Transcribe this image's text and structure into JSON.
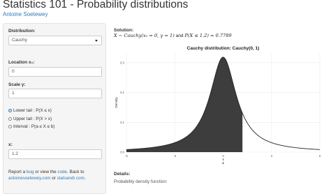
{
  "header": {
    "title": "Statistics 101 - Probability distributions",
    "author": "Antoine Soetewey"
  },
  "sidebar": {
    "distribution_label": "Distribution:",
    "distribution_value": "Cauchy",
    "location_label": "Location x₀:",
    "location_value": "0",
    "scale_label": "Scale γ:",
    "scale_value": "1",
    "tail_options": [
      "Lower tail : P(X ≤ x)",
      "Upper tail : P(X > x)",
      "Interval : P(a ≤ X ≤ b)"
    ],
    "selected_tail": 0,
    "x_label": "x:",
    "x_value": "1.2",
    "footer": {
      "t1": "Report a ",
      "bug": "bug",
      "t2": " or view the ",
      "code": "code",
      "t3": ". Back to",
      "site1": "antoinesoetewey.com",
      "t4": " or ",
      "site2": "statsandr.com",
      "t5": "."
    }
  },
  "solution": {
    "label": "Solution:",
    "line1": "X ∼ Cauchy(x₀ = 0, γ = 1)",
    "and": " and ",
    "line2": "P(X ≤ 1.2) = 0.7789"
  },
  "details": {
    "label": "Details:",
    "text": "Probability density function:"
  },
  "chart_data": {
    "type": "area",
    "title": "Cauchy distribution: Cauchy(0, 1)",
    "ylabel": "Density",
    "xlabel": "",
    "x_ticks": [
      "-6",
      "-3",
      "0",
      "3",
      "6"
    ],
    "y_ticks": [
      "0.0",
      "0.1",
      "0.2",
      "0.3"
    ],
    "xlim": [
      -6,
      6
    ],
    "ylim": [
      0,
      0.3183
    ],
    "location": 0,
    "scale": 1,
    "shade_upper": 1.2,
    "x_marker": "x",
    "colors": {
      "fill": "#3d3d3d",
      "grid": "#ebebeb",
      "curve": "#222222",
      "marker": "#222222"
    }
  }
}
